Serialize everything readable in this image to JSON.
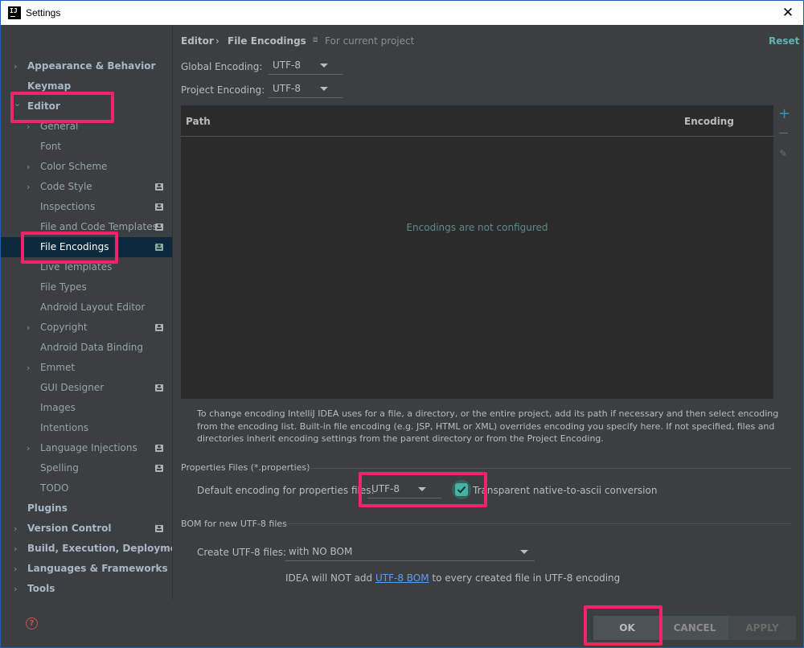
{
  "window": {
    "title": "Settings",
    "app_icon": "IJ"
  },
  "sidebar": {
    "items": [
      {
        "label": "Appearance & Behavior",
        "level": 0,
        "expandable": true,
        "expanded": false,
        "project": false
      },
      {
        "label": "Keymap",
        "level": 0,
        "expandable": false,
        "expanded": false,
        "project": false
      },
      {
        "label": "Editor",
        "level": 0,
        "expandable": true,
        "expanded": true,
        "project": false
      },
      {
        "label": "General",
        "level": 1,
        "expandable": true,
        "expanded": false,
        "project": false
      },
      {
        "label": "Font",
        "level": 1,
        "expandable": false,
        "expanded": false,
        "project": false
      },
      {
        "label": "Color Scheme",
        "level": 1,
        "expandable": true,
        "expanded": false,
        "project": false
      },
      {
        "label": "Code Style",
        "level": 1,
        "expandable": true,
        "expanded": false,
        "project": true
      },
      {
        "label": "Inspections",
        "level": 1,
        "expandable": false,
        "expanded": false,
        "project": true
      },
      {
        "label": "File and Code Templates",
        "level": 1,
        "expandable": false,
        "expanded": false,
        "project": true
      },
      {
        "label": "File Encodings",
        "level": 1,
        "expandable": false,
        "expanded": false,
        "project": true,
        "selected": true
      },
      {
        "label": "Live Templates",
        "level": 1,
        "expandable": false,
        "expanded": false,
        "project": false
      },
      {
        "label": "File Types",
        "level": 1,
        "expandable": false,
        "expanded": false,
        "project": false
      },
      {
        "label": "Android Layout Editor",
        "level": 1,
        "expandable": false,
        "expanded": false,
        "project": false
      },
      {
        "label": "Copyright",
        "level": 1,
        "expandable": true,
        "expanded": false,
        "project": true
      },
      {
        "label": "Android Data Binding",
        "level": 1,
        "expandable": false,
        "expanded": false,
        "project": false
      },
      {
        "label": "Emmet",
        "level": 1,
        "expandable": true,
        "expanded": false,
        "project": false
      },
      {
        "label": "GUI Designer",
        "level": 1,
        "expandable": false,
        "expanded": false,
        "project": true
      },
      {
        "label": "Images",
        "level": 1,
        "expandable": false,
        "expanded": false,
        "project": false
      },
      {
        "label": "Intentions",
        "level": 1,
        "expandable": false,
        "expanded": false,
        "project": false
      },
      {
        "label": "Language Injections",
        "level": 1,
        "expandable": true,
        "expanded": false,
        "project": true
      },
      {
        "label": "Spelling",
        "level": 1,
        "expandable": false,
        "expanded": false,
        "project": true
      },
      {
        "label": "TODO",
        "level": 1,
        "expandable": false,
        "expanded": false,
        "project": false
      },
      {
        "label": "Plugins",
        "level": 0,
        "expandable": false,
        "expanded": false,
        "project": false
      },
      {
        "label": "Version Control",
        "level": 0,
        "expandable": true,
        "expanded": false,
        "project": true
      },
      {
        "label": "Build, Execution, Deployment",
        "level": 0,
        "expandable": true,
        "expanded": false,
        "project": false
      },
      {
        "label": "Languages & Frameworks",
        "level": 0,
        "expandable": true,
        "expanded": false,
        "project": false
      },
      {
        "label": "Tools",
        "level": 0,
        "expandable": true,
        "expanded": false,
        "project": false
      }
    ],
    "help_icon": "?"
  },
  "header": {
    "breadcrumb_root": "Editor",
    "breadcrumb_sep": "›",
    "breadcrumb_page": "File Encodings",
    "scope_icon": "project-scope-icon",
    "scope_label": "For current project",
    "reset_label": "Reset"
  },
  "encodings": {
    "global_label": "Global Encoding:",
    "global_value": "UTF-8",
    "project_label": "Project Encoding:",
    "project_value": "UTF-8"
  },
  "table": {
    "col_path": "Path",
    "col_encoding": "Encoding",
    "empty_text": "Encodings are not configured",
    "add_symbol": "+",
    "edit_symbol": "✎"
  },
  "description": "To change encoding IntelliJ IDEA uses for a file, a directory, or the entire project, add its path if necessary and then select encoding from the encoding list. Built-in file encoding (e.g. JSP, HTML or XML) overrides encoding you specify here. If not specified, files and directories inherit encoding settings from the parent directory or from the Project Encoding.",
  "properties": {
    "section_title": "Properties Files (*.properties)",
    "default_label": "Default encoding for properties files:",
    "default_value": "UTF-8",
    "native_ascii_label": "Transparent native-to-ascii conversion",
    "native_ascii_checked": true
  },
  "bom": {
    "section_title": "BOM for new UTF-8 files",
    "create_label": "Create UTF-8 files:",
    "create_value": "with NO BOM",
    "note_prefix": "IDEA will NOT add ",
    "note_link": "UTF-8 BOM",
    "note_suffix": " to every created file in UTF-8 encoding"
  },
  "buttons": {
    "ok": "OK",
    "cancel": "CANCEL",
    "apply": "APPLY"
  },
  "colors": {
    "highlight": "#f2236a",
    "accent_teal": "#43b3a4",
    "link": "#589df6",
    "selection": "#0d293e"
  }
}
